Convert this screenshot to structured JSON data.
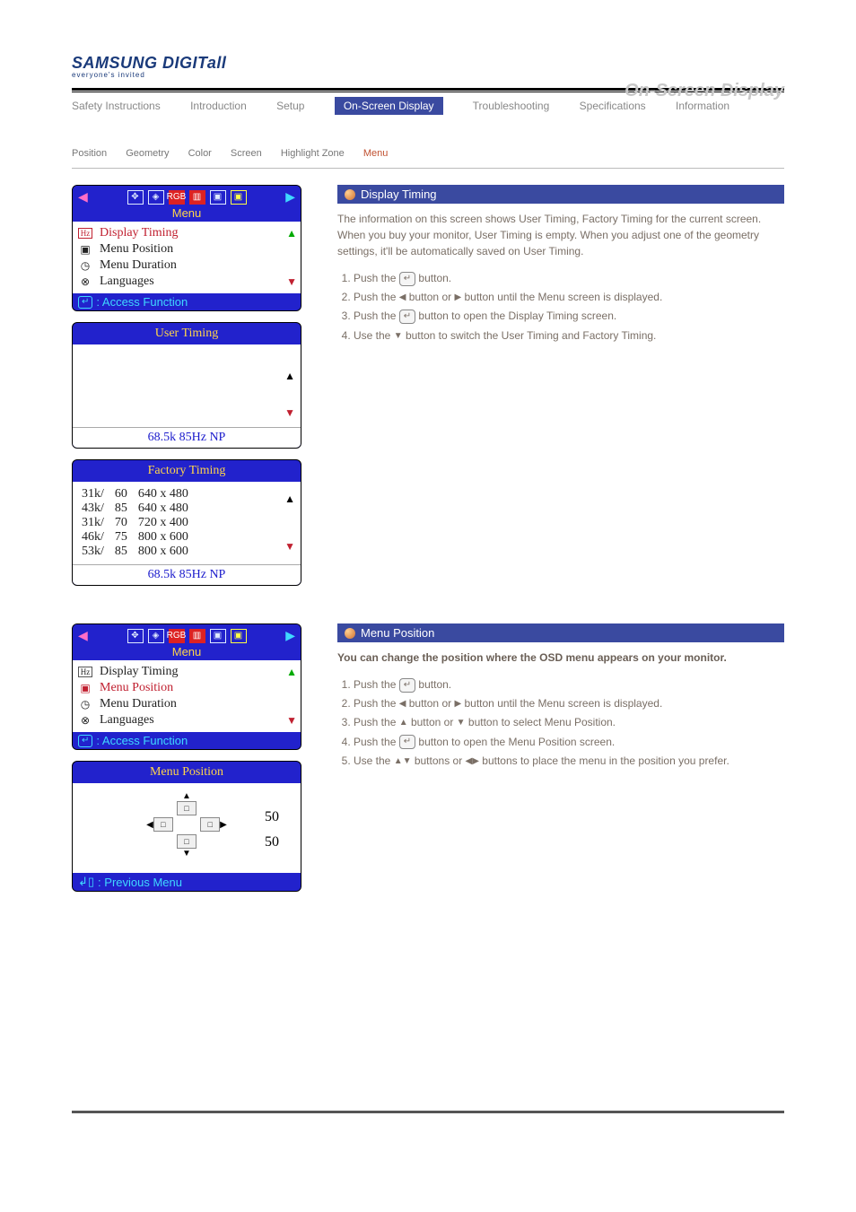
{
  "logo": {
    "brand": "SAMSUNG DIGITall",
    "sub": "everyone's invited"
  },
  "page_title": "On-Screen Display",
  "tabs": {
    "items": [
      "Safety Instructions",
      "Introduction",
      "Setup",
      "On-Screen Display",
      "Troubleshooting",
      "Specifications",
      "Information"
    ]
  },
  "subnav": {
    "items": [
      "Position",
      "Geometry",
      "Color",
      "Screen",
      "Highlight Zone",
      "Menu"
    ]
  },
  "osd_menu": {
    "menu_label": "Menu",
    "items": [
      "Display Timing",
      "Menu Position",
      "Menu Duration",
      "Languages"
    ],
    "hint": ": Access Function"
  },
  "user_timing": {
    "title": "User Timing",
    "status": "68.5k      85Hz    NP"
  },
  "factory_timing": {
    "title": "Factory Timing",
    "rows": [
      {
        "khz": "31k/",
        "hz": "60",
        "res": "640 x 480"
      },
      {
        "khz": "43k/",
        "hz": "85",
        "res": "640 x 480"
      },
      {
        "khz": "31k/",
        "hz": "70",
        "res": "720 x 400"
      },
      {
        "khz": "46k/",
        "hz": "75",
        "res": "800 x 600"
      },
      {
        "khz": "53k/",
        "hz": "85",
        "res": "800 x 600"
      }
    ],
    "status": "68.5k      85Hz    NP"
  },
  "display_timing_info": {
    "header": "Display Timing",
    "desc": "The information on this screen shows User Timing, Factory Timing for the current screen. When you buy your monitor, User Timing is empty. When you adjust one of the geometry settings, it'll be automatically saved on User Timing.",
    "steps": [
      {
        "text": "Push the ",
        "tail": " button."
      },
      {
        "text": "Push the ",
        "mid": " button or ",
        "tail": " button until the Menu screen is displayed."
      },
      {
        "text": "Push the ",
        "tail": " button to open the Display Timing screen."
      },
      {
        "text": "Use the ",
        "tail": " button to switch the User Timing and Factory Timing."
      }
    ]
  },
  "menu_position_info": {
    "header": "Menu Position",
    "desc_bold": "You can change the position where the OSD menu appears on your monitor.",
    "steps": [
      {
        "text": "Push the ",
        "tail": " button."
      },
      {
        "text": "Push the ",
        "mid": " button or ",
        "tail": " button until the Menu screen is displayed."
      },
      {
        "text": "Push the ",
        "mid": " button or ",
        "tail": " button to select Menu Position."
      },
      {
        "text": "Push the ",
        "tail": " button to open the Menu Position screen."
      },
      {
        "text": "Use the ",
        "mid": " buttons or ",
        "tail": " buttons to place the menu in the position you prefer."
      }
    ]
  },
  "osd_menu2": {
    "menu_label": "Menu",
    "items": [
      "Display Timing",
      "Menu Position",
      "Menu Duration",
      "Languages"
    ],
    "hint": ": Access Function"
  },
  "menu_position_panel": {
    "title": "Menu Position",
    "val1": "50",
    "val2": "50",
    "foot": ": Previous Menu"
  }
}
